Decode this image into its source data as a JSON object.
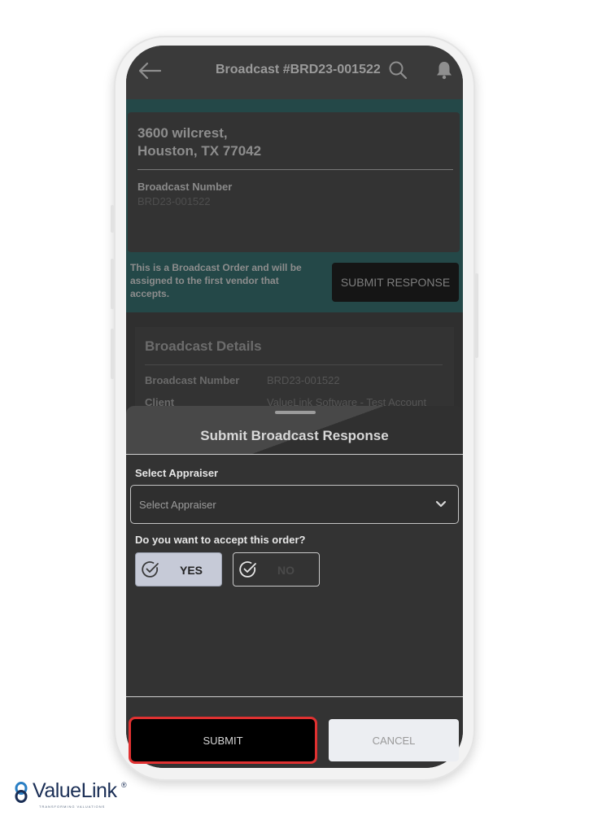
{
  "header": {
    "title": "Broadcast #BRD23-001522",
    "back_icon": "arrow-left-icon",
    "search_icon": "search-icon",
    "notification_icon": "bell-icon"
  },
  "address_card": {
    "line1": "3600 wilcrest,",
    "line2": "Houston, TX 77042",
    "label": "Broadcast Number",
    "value": "BRD23-001522"
  },
  "broadcast_note": "This is a Broadcast Order and will be assigned to the first vendor that accepts.",
  "submit_response_label": "SUBMIT RESPONSE",
  "details": {
    "title": "Broadcast Details",
    "rows": [
      {
        "label": "Broadcast Number",
        "value": "BRD23-001522"
      },
      {
        "label": "Client",
        "value": "ValueLink Software - Test Account"
      }
    ]
  },
  "sheet": {
    "title": "Submit Broadcast Response",
    "appraiser_label": "Select Appraiser",
    "appraiser_placeholder": "Select Appraiser",
    "accept_question": "Do you want to accept this order?",
    "yes_label": "YES",
    "no_label": "NO",
    "selected_option": "YES"
  },
  "footer": {
    "submit_label": "SUBMIT",
    "cancel_label": "CANCEL"
  },
  "brand": {
    "name": "ValueLink",
    "registered": "®",
    "tagline": "TRANSFORMING VALUATIONS"
  },
  "colors": {
    "teal_band": "#244848",
    "submit_highlight": "#e03131",
    "brand_blue": "#1a2e55"
  }
}
